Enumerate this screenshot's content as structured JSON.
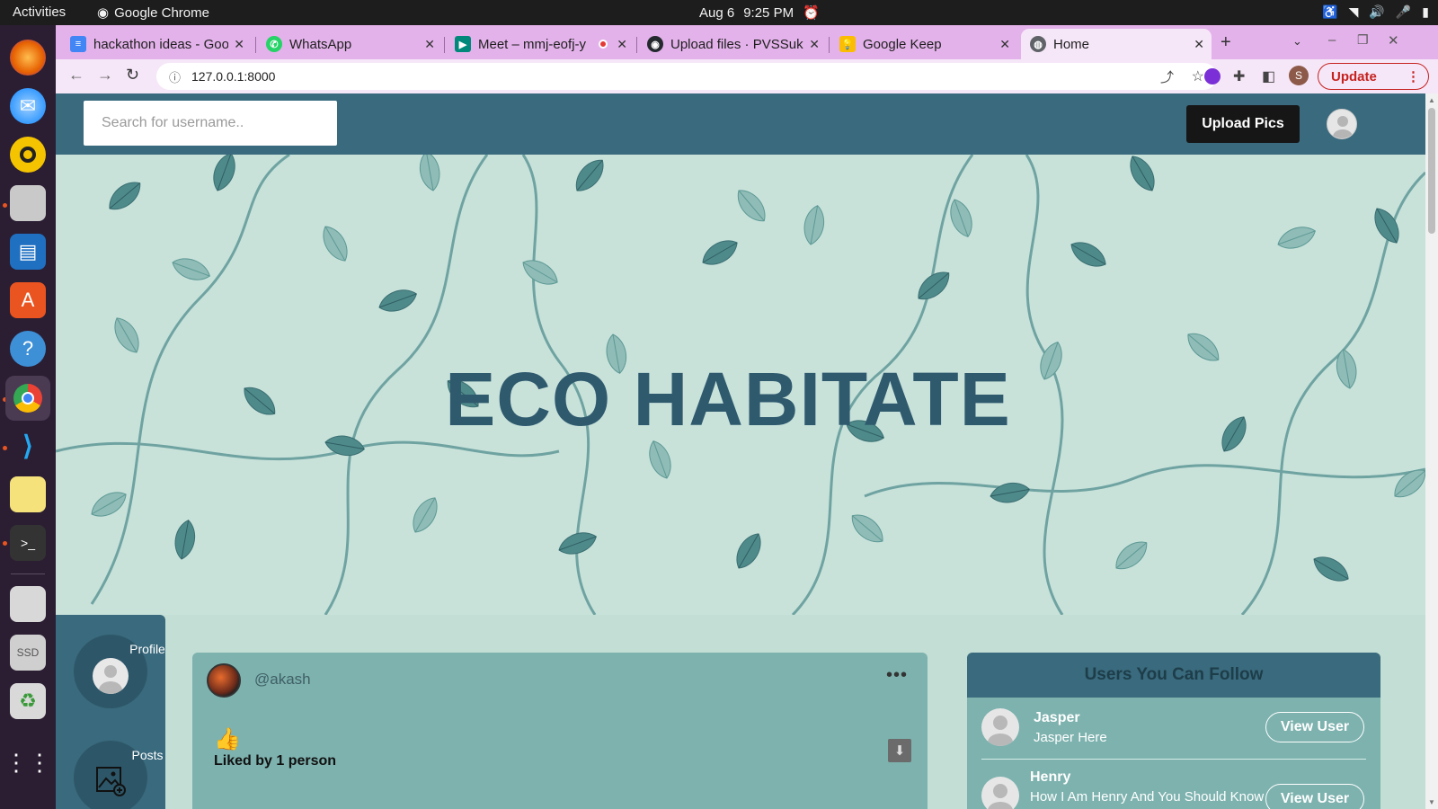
{
  "system": {
    "activities": "Activities",
    "app_name": "Google Chrome",
    "date": "Aug 6",
    "time": "9:25 PM"
  },
  "tabs": [
    {
      "label": "hackathon ideas - Goo",
      "icon": "docs-icon",
      "color": "#4285f4"
    },
    {
      "label": "WhatsApp",
      "icon": "whatsapp-icon",
      "color": "#25d366"
    },
    {
      "label": "Meet – mmj-eofj-y",
      "icon": "meet-icon",
      "color": "#00897b"
    },
    {
      "label": "Upload files · PVSSuk",
      "icon": "github-icon",
      "color": "#24292e"
    },
    {
      "label": "Google Keep",
      "icon": "keep-icon",
      "color": "#fbbc04"
    },
    {
      "label": "Home",
      "icon": "globe-icon",
      "color": "#5f6368"
    }
  ],
  "toolbar": {
    "url": "127.0.0.1:8000",
    "update_label": "Update",
    "profile_initial": "S"
  },
  "header": {
    "search_placeholder": "Search for username..",
    "upload_label": "Upload Pics"
  },
  "hero": {
    "title": "ECO HABITATE"
  },
  "sidebar": {
    "items": [
      {
        "label": "Profile"
      },
      {
        "label": "Posts"
      }
    ]
  },
  "post": {
    "username": "@akash",
    "liked_text": "Liked by 1 person"
  },
  "follow": {
    "title": "Users You Can Follow",
    "users": [
      {
        "name": "Jasper",
        "bio": "Jasper Here",
        "button": "View User"
      },
      {
        "name": "Henry",
        "bio": "How I Am Henry And You Should Know",
        "button": "View User"
      }
    ]
  },
  "colors": {
    "header": "#3a6a7d",
    "page_bg": "#c3ded4",
    "card": "#7db2ae",
    "tabstrip": "#e3b2ea",
    "dock": "#2b1e33"
  }
}
